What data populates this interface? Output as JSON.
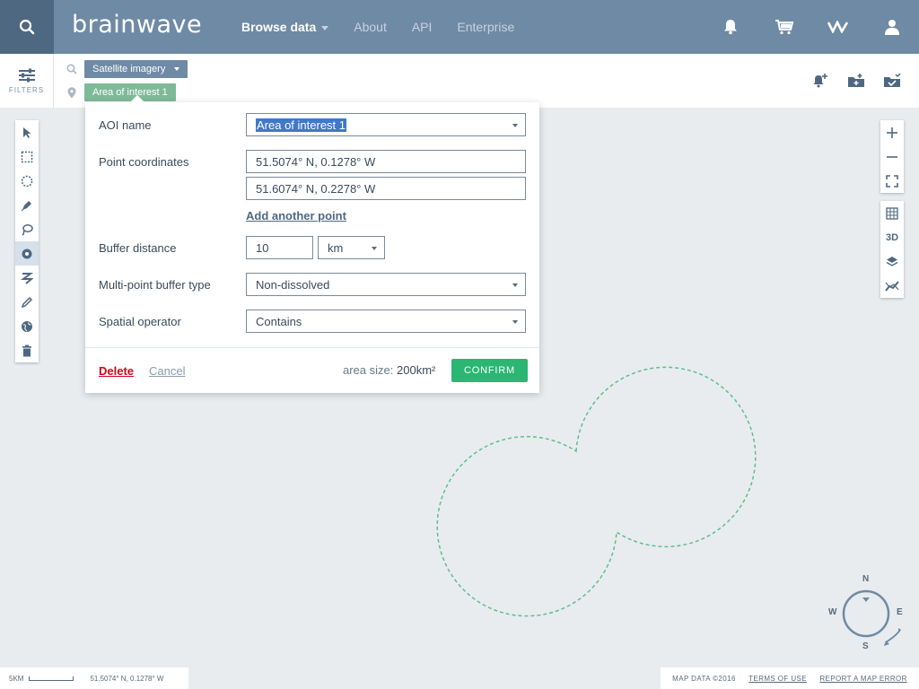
{
  "app": {
    "logo": "brainwave"
  },
  "nav": {
    "items": [
      {
        "label": "Browse data",
        "active": true,
        "dropdown": true
      },
      {
        "label": "About"
      },
      {
        "label": "API"
      },
      {
        "label": "Enterprise"
      }
    ]
  },
  "header_icons": [
    "bell-icon",
    "cart-icon",
    "brand-mark-icon",
    "user-icon"
  ],
  "filters": {
    "label": "FILTERS",
    "dataset_chip": "Satellite imagery",
    "aoi_chip": "Area of interest 1",
    "action_icons": [
      "add-alert-icon",
      "add-to-folder-icon",
      "saved-folder-icon"
    ]
  },
  "tools": [
    "pointer-icon",
    "rectangle-select-icon",
    "circle-select-icon",
    "pen-icon",
    "lasso-icon",
    "point-buffer-icon",
    "path-icon",
    "edit-icon",
    "globe-icon",
    "trash-icon"
  ],
  "aoi_popup": {
    "name_label": "AOI name",
    "name_value": "Area of interest 1",
    "coords_label": "Point coordinates",
    "coord_1": "51.5074° N, 0.1278° W",
    "coord_2": "51.6074° N, 0.2278° W",
    "add_point": "Add another point",
    "buffer_label": "Buffer distance",
    "buffer_value": "10",
    "buffer_unit": "km",
    "multi_label": "Multi-point buffer type",
    "multi_value": "Non-dissolved",
    "operator_label": "Spatial operator",
    "operator_value": "Contains",
    "delete": "Delete",
    "cancel": "Cancel",
    "area_label": "area size:",
    "area_value": "200km²",
    "confirm": "CONFIRM"
  },
  "map_controls": {
    "view_3d": "3D"
  },
  "compass": {
    "n": "N",
    "s": "S",
    "e": "E",
    "w": "W"
  },
  "status": {
    "scale": "5KM",
    "cursor_coords": "51.5074° N, 0.1278° W",
    "map_data": "MAP DATA ©2016",
    "terms": "TERMS OF USE",
    "report": "REPORT A MAP ERROR"
  },
  "colors": {
    "header": "#6f8aa5",
    "header_dark": "#4f6882",
    "accent_green": "#2bb673",
    "buffer_outline": "#5fbf8a",
    "delete_red": "#d0021b"
  }
}
